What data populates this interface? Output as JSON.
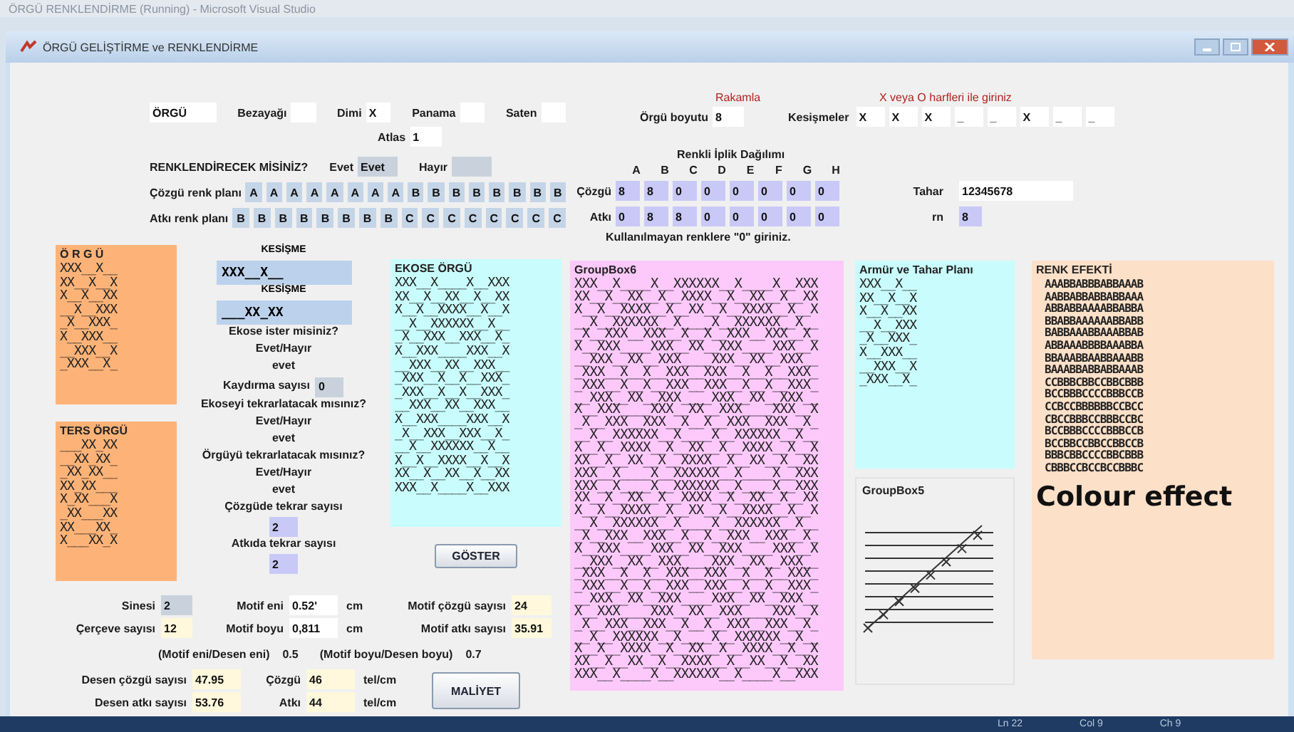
{
  "ide": {
    "title": "ÖRGÜ RENKLENDİRME (Running) - Microsoft Visual Studio"
  },
  "window": {
    "title": "ÖRGÜ GELİŞTİRME ve RENKLENDİRME"
  },
  "weave_row": {
    "name_value": "ÖRGÜ",
    "fields": [
      {
        "label": "Bezayağı"
      },
      {
        "label": "Dimi",
        "value": "X"
      },
      {
        "label": "Panama"
      },
      {
        "label": "Saten"
      }
    ]
  },
  "atlas": {
    "label": "Atlas",
    "value": "1"
  },
  "colorize": {
    "question": "RENKLENDİRECEK MİSİNİZ?",
    "yes_label": "Evet",
    "yes_value": "Evet",
    "no_label": "Hayır"
  },
  "warp_plan": {
    "label": "Çözgü renk planı",
    "cells": [
      "A",
      "A",
      "A",
      "A",
      "A",
      "A",
      "A",
      "A",
      "B",
      "B",
      "B",
      "B",
      "B",
      "B",
      "B",
      "B"
    ]
  },
  "weft_plan": {
    "label": "Atkı renk planı",
    "cells": [
      "B",
      "B",
      "B",
      "B",
      "B",
      "B",
      "B",
      "B",
      "C",
      "C",
      "C",
      "C",
      "C",
      "C",
      "C",
      "C"
    ]
  },
  "size": {
    "hint": "Rakamla",
    "label": "Örgü boyutu",
    "value": "8"
  },
  "intersections": {
    "hint": "X veya O harfleri ile giriniz",
    "label": "Kesişmeler",
    "cells": [
      "X",
      "X",
      "X",
      "_",
      "_",
      "X",
      "_",
      "_"
    ]
  },
  "distribution": {
    "title": "Renkli İplik Dağılımı",
    "letters": [
      "A",
      "B",
      "C",
      "D",
      "E",
      "F",
      "G",
      "H"
    ],
    "rows": [
      {
        "label": "Çözgü",
        "cells": [
          "8",
          "8",
          "0",
          "0",
          "0",
          "0",
          "0",
          "0"
        ]
      },
      {
        "label": "Atkı",
        "cells": [
          "0",
          "8",
          "8",
          "0",
          "0",
          "0",
          "0",
          "0"
        ]
      }
    ],
    "note": "Kullanılmayan renklere \"0\" giriniz."
  },
  "tahar": {
    "label": "Tahar",
    "value": "12345678"
  },
  "rn": {
    "label": "rn",
    "value": "8"
  },
  "weave_box": {
    "title": "Ö R G Ü",
    "rows": [
      "XXX__X__",
      "XX__X__X",
      "X__X__XX",
      "__X__XXX",
      "_X__XXX_",
      "X__XXX__",
      "__XXX__X",
      "_XXX__X_"
    ]
  },
  "reverse_box": {
    "title": "TERS ÖRGÜ",
    "rows": [
      "___XX_XX",
      "__XX_XX_",
      "_XX_XX__",
      "XX_XX___",
      "X_XX___X",
      "_XX___XX",
      "XX___XX_",
      "X___XX_X"
    ]
  },
  "options": [
    {
      "kind": "caption",
      "text": "KESİŞME"
    },
    {
      "kind": "strip",
      "value": "XXX__X__"
    },
    {
      "kind": "caption",
      "text": "KESİŞME"
    },
    {
      "kind": "strip",
      "value": "___XX_XX"
    },
    {
      "kind": "text",
      "text": "Ekose ister misiniz?"
    },
    {
      "kind": "text",
      "text": "Evet/Hayır"
    },
    {
      "kind": "text",
      "text": "evet"
    },
    {
      "kind": "pair",
      "text": "Kaydırma sayısı",
      "value": "0"
    },
    {
      "kind": "text",
      "text": "Ekoseyi tekrarlatacak mısınız?"
    },
    {
      "kind": "text",
      "text": "Evet/Hayır"
    },
    {
      "kind": "text",
      "text": "evet"
    },
    {
      "kind": "text",
      "text": "Örgüyü tekrarlatacak mısınız?"
    },
    {
      "kind": "text",
      "text": "Evet/Hayır"
    },
    {
      "kind": "text",
      "text": "evet"
    },
    {
      "kind": "text",
      "text": "Çözgüde tekrar sayısı"
    },
    {
      "kind": "field",
      "value": "2"
    },
    {
      "kind": "text",
      "text": "Atkıda tekrar sayısı"
    },
    {
      "kind": "field",
      "value": "2"
    }
  ],
  "ekose_box": {
    "title": "EKOSE ÖRGÜ",
    "rows": [
      "XXX__X____X__XXX",
      "XX__X__XX__X__XX",
      "X__X__XXXX__X__X",
      "__X__XXXXXX__X__",
      "_X__XXX__XXX__X_",
      "X__XXX____XXX__X",
      "__XXX__XX__XXX__",
      "_XXX__X__X__XXX_",
      "_XXX__X__X__XXX_",
      "__XXX__XX__XXX__",
      "X__XXX____XXX__X",
      "_X__XXX__XXX__X_",
      "__X__XXXXXX__X__",
      "X__X__XXXX__X__X",
      "XX__X__XX__X__XX",
      "XXX__X____X__XXX"
    ]
  },
  "show_button": "GÖSTER",
  "group6": {
    "title": "GroupBox6",
    "rows": [
      "XXX__X____X__XXXXXX__X____X__XXX",
      "XX__X__XX__X__XXXX__X__XX__X__XX",
      "X__X__XXXX__X__XX__X__XXXX__X__X",
      "__X__XXXXXX__X____X__XXXXXX__X__",
      "_X__XXX__XXX__X__X__XXX__XXX__X_",
      "X__XXX____XXX__XX__XXX____XXX__X",
      "__XXX__XX__XXX____XXX__XX__XXX__",
      "_XXX__X__X__XXX__XXX__X__X__XXX_",
      "_XXX__X__X__XXX__XXX__X__X__XXX_",
      "__XXX__XX__XXX____XXX__XX__XXX__",
      "X__XXX____XXX__XX__XXX____XXX__X",
      "_X__XXX__XXX__X__X__XXX__XXX__X_",
      "__X__XXXXXX__X____X__XXXXXX__X__",
      "X__X__XXXX__X__XX__X__XXXX__X__X",
      "XX__X__XX__X__XXXX__X__XX__X__XX",
      "XXX__X____X__XXXXXX__X____X__XXX",
      "XXX__X____X__XXXXXX__X____X__XXX",
      "XX__X__XX__X__XXXX__X__XX__X__XX",
      "X__X__XXXX__X__XX__X__XXXX__X__X",
      "__X__XXXXXX__X____X__XXXXXX__X__",
      "_X__XXX__XXX__X__X__XXX__XXX__X_",
      "X__XXX____XXX__XX__XXX____XXX__X",
      "__XXX__XX__XXX____XXX__XX__XXX__",
      "_XXX__X__X__XXX__XXX__X__X__XXX_",
      "_XXX__X__X__XXX__XXX__X__X__XXX_",
      "__XXX__XX__XXX____XXX__XX__XXX__",
      "X__XXX____XXX__XX__XXX____XXX__X",
      "_X__XXX__XXX__X__X__XXX__XXX__X_",
      "__X__XXXXXX__X____X__XXXXXX__X__",
      "X__X__XXXX__X__XX__X__XXXX__X__X",
      "XX__X__XX__X__XXXX__X__XX__X__XX",
      "XXX__X____X__XXXXXX__X____X__XXX"
    ]
  },
  "armur": {
    "title": "Armür ve Tahar Planı",
    "rows": [
      "XXX__X__",
      "XX__X__X",
      "X__X__XX",
      "__X__XXX",
      "_X__XXX_",
      "X__XXX__",
      "__XXX__X",
      "_XXX__X_"
    ]
  },
  "group5": {
    "title": "GroupBox5"
  },
  "color_effect": {
    "title": "RENK EFEKTİ",
    "caption": "Colour effect",
    "rows": [
      "AAABBABBBABBAAAB",
      "AABBABBABBABBAAA",
      "ABBABBAAAABBABBA",
      "BBABBAAAAAABBABB",
      "BABBAAABBAAABBAB",
      "ABBAAABBBBAAABBA",
      "BBAAABBAABBAAABB",
      "BAAABBABBABBAAAB",
      "CCBBBCBBCCBBCBBB",
      "BCCBBBCCCCBBBCCB",
      "CCBCCBBBBBBCCBCC",
      "CBCCBBBCCBBBCCBC",
      "BCCBBBCCCCBBBCCB",
      "BCCBBCCBBCCBBCCB",
      "BBBCBBCCCCBBCBBB",
      "CBBBCCBCCBCCBBBC"
    ]
  },
  "results": {
    "heddle": {
      "label": "Sinesi",
      "value": "2"
    },
    "frames": {
      "label": "Çerçeve sayısı",
      "value": "12"
    },
    "motif_width": {
      "label": "Motif eni",
      "value": "0.52'",
      "unit": "cm"
    },
    "motif_height": {
      "label": "Motif boyu",
      "value": "0,811",
      "unit": "cm"
    },
    "motif_warp": {
      "label": "Motif çözgü sayısı",
      "value": "24"
    },
    "motif_weft": {
      "label": "Motif atkı sayısı",
      "value": "35.91"
    },
    "width_ratio": {
      "label": "(Motif eni/Desen eni)",
      "value": "0.5"
    },
    "height_ratio": {
      "label": "(Motif boyu/Desen boyu)",
      "value": "0.7"
    },
    "design_warp": {
      "label": "Desen çözgü sayısı",
      "value": "47.95"
    },
    "design_weft": {
      "label": "Desen atkı sayısı",
      "value": "53.76"
    },
    "warp_density": {
      "label": "Çözgü",
      "value": "46",
      "unit": "tel/cm"
    },
    "weft_density": {
      "label": "Atkı",
      "value": "44",
      "unit": "tel/cm"
    },
    "cost_button": "MALİYET"
  },
  "status_bar": [
    "Ln 22",
    "Col 9",
    "Ch 9"
  ]
}
